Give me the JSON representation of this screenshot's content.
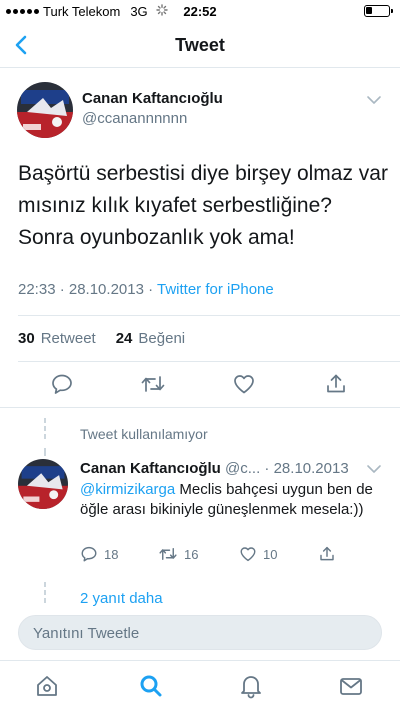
{
  "status_bar": {
    "carrier": "Turk Telekom",
    "network": "3G",
    "time": "22:52",
    "battery_level": 0.3
  },
  "nav": {
    "title": "Tweet",
    "back_icon": "chevron-left-icon"
  },
  "tweet": {
    "author_name": "Canan Kaftancıoğlu",
    "author_handle": "@ccanannnnnn",
    "text": "Başörtü serbestisi diye birşey olmaz var mısınız kılık kıyafet serbestliğine? Sonra oyunbozanlık yok ama!",
    "meta_time": "22:33 · 28.10.2013 · ",
    "meta_source": "Twitter for iPhone",
    "retweet_count": "30",
    "retweet_label": "Retweet",
    "like_count": "24",
    "like_label": "Beğeni"
  },
  "thread": {
    "unavailable_text": "Tweet kullanılamıyor",
    "reply": {
      "author_name": "Canan Kaftancıoğlu",
      "handle_date": " @c... · 28.10.2013",
      "mention": "@kirmizikarga",
      "text": " Meclis bahçesi uygun ben de öğle arası bikiniyle güneşlenmek mesela:))",
      "reply_count": "18",
      "retweet_count": "16",
      "like_count": "10"
    },
    "more_replies": "2 yanıt daha"
  },
  "compose": {
    "placeholder": "Yanıtını Tweetle"
  },
  "tabbar": {
    "items": [
      "home-icon",
      "search-icon",
      "notifications-icon",
      "messages-icon"
    ],
    "active": "search-icon"
  },
  "colors": {
    "accent": "#1da1f2",
    "secondary_text": "#657786",
    "divider": "#e1e8ed"
  }
}
